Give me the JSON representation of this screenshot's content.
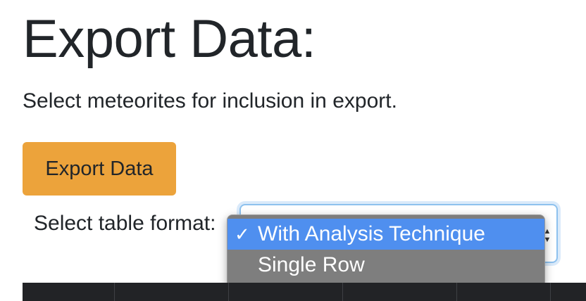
{
  "page": {
    "title": "Export Data:",
    "subtitle": "Select meteorites for inclusion in export.",
    "export_button_label": "Export Data",
    "format_label": "Select table format:"
  },
  "select": {
    "selected_value": "With Analysis Technique",
    "options": [
      {
        "label": "With Analysis Technique",
        "selected": true
      },
      {
        "label": "Single Row",
        "selected": false
      }
    ],
    "check_icon": "check-icon"
  },
  "colors": {
    "button": "#eca33b",
    "dropdown_background": "#7e7e7e",
    "selected_option": "#4f8fef",
    "table_header": "#222326"
  }
}
